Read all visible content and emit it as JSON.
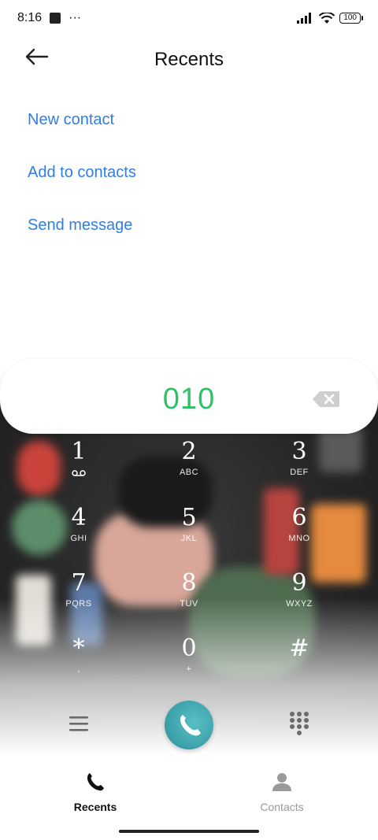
{
  "status_bar": {
    "time": "8:16",
    "dots": "···",
    "battery": "100"
  },
  "header": {
    "title": "Recents"
  },
  "menu": [
    {
      "label": "New contact"
    },
    {
      "label": "Add to contacts"
    },
    {
      "label": "Send message"
    }
  ],
  "dialer": {
    "number": "010"
  },
  "keys": [
    {
      "digit": "1",
      "letters": "",
      "icon": "voicemail-icon"
    },
    {
      "digit": "2",
      "letters": "ABC"
    },
    {
      "digit": "3",
      "letters": "DEF"
    },
    {
      "digit": "4",
      "letters": "GHI"
    },
    {
      "digit": "5",
      "letters": "JKL"
    },
    {
      "digit": "6",
      "letters": "MNO"
    },
    {
      "digit": "7",
      "letters": "PQRS"
    },
    {
      "digit": "8",
      "letters": "TUV"
    },
    {
      "digit": "9",
      "letters": "WXYZ"
    },
    {
      "digit": "*",
      "letters": ","
    },
    {
      "digit": "0",
      "letters": "+"
    },
    {
      "digit": "#",
      "letters": ""
    }
  ],
  "bottom_nav": {
    "recents": {
      "label": "Recents",
      "icon": "phone-icon",
      "color": "#111111"
    },
    "contacts": {
      "label": "Contacts",
      "icon": "person-icon",
      "color": "#9a9a9a"
    }
  },
  "colors": {
    "accent": "#2f7ee8",
    "number": "#2ec266",
    "call": "#3ea3ac"
  }
}
